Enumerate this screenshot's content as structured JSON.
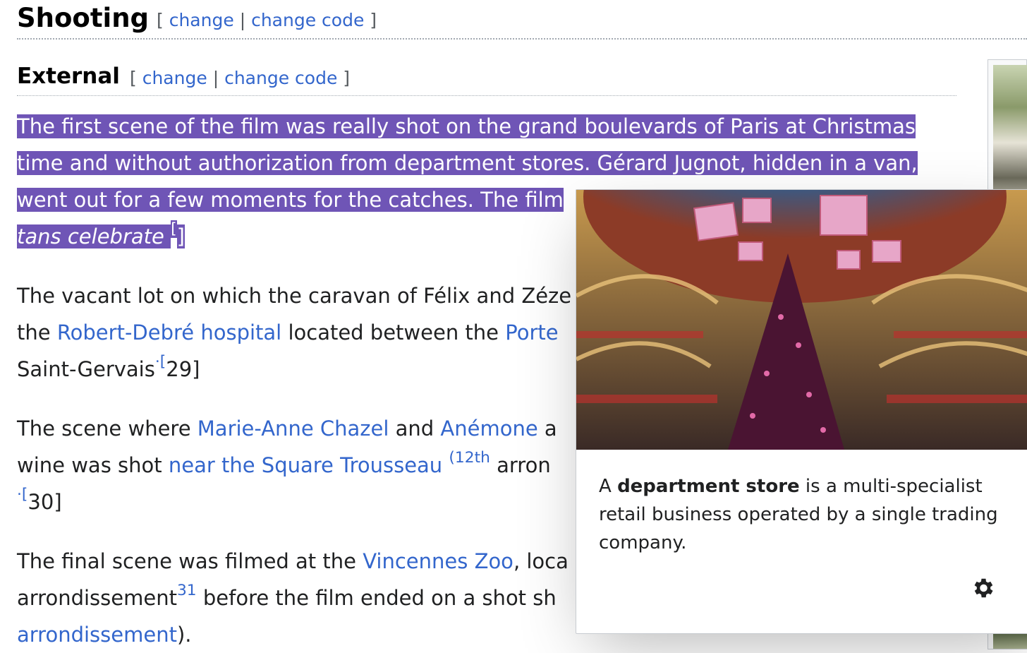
{
  "section": {
    "title": "Shooting",
    "edit_open": "[",
    "edit_change": "change",
    "edit_sep": "|",
    "edit_change_code": "change code",
    "edit_close": "]"
  },
  "subsection": {
    "title": "External",
    "edit_open": "[",
    "edit_change": "change",
    "edit_sep": "|",
    "edit_change_code": "change code",
    "edit_close": "]"
  },
  "paragraphs": {
    "p1": {
      "line1": "The first scene of the film was really shot on the grand boulevards of Paris at Christmas",
      "line2": "time and without authorization from department stores. Gérard Jugnot, hidden in a van,",
      "line3": "went out for a few moments for the catches. The film",
      "line4_italic": "tans celebrate",
      "ref_open": "[",
      "ref_close": "]"
    },
    "p2": {
      "line1": "The vacant lot on which the caravan of Félix and Zéze",
      "line2_pre": "the ",
      "link_hospital": "Robert-Debré hospital",
      "line2_mid": " located between the ",
      "link_porte": "Porte",
      "line3_pre": "Saint-Gervais",
      "ref_open": "·[",
      "ref_num": "29",
      "ref_close": "]"
    },
    "p3": {
      "line1_pre": "The scene where ",
      "link_chazel": "Marie-Anne Chazel",
      "line1_mid": " and ",
      "link_anemone": "Anémone",
      "line1_post": " a",
      "line2_pre": "wine was shot ",
      "link_trousseau": "near the Square Trousseau",
      "sup_arr": "(12th",
      "line2_post": " arron",
      "ref_open": "·[",
      "ref_num": "30",
      "ref_close": "]"
    },
    "p4": {
      "line1_pre": "The final scene was filmed at the ",
      "link_zoo": "Vincennes Zoo",
      "line1_post": ", loca",
      "line2_pre": "arrondissement",
      "sup_31": "31",
      "line2_post": " before the film ended on a shot sh",
      "link_arr": "arrondissement",
      "line3_post": ")."
    }
  },
  "popup": {
    "extract_pre": "A ",
    "extract_bold": "department store",
    "extract_post": " is a multi-specialist retail business operated by a single trading company.",
    "settings_icon": "gear-icon"
  },
  "colors": {
    "link": "#3366cc",
    "selection": "#6f55b6"
  }
}
